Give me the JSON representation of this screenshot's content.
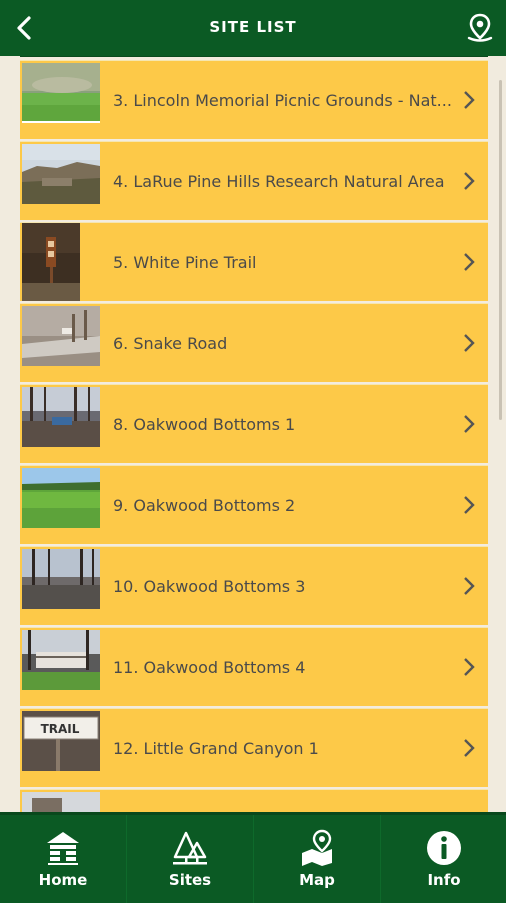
{
  "header": {
    "title": "SITE LIST",
    "back_icon": "back-chevron-icon",
    "map_pin_icon": "location-pin-icon"
  },
  "sites": [
    {
      "label": "3. Lincoln Memorial Picnic Grounds - Nat..."
    },
    {
      "label": "4. LaRue Pine Hills Research Natural Area"
    },
    {
      "label": "5. White Pine Trail"
    },
    {
      "label": "6. Snake Road"
    },
    {
      "label": "8. Oakwood Bottoms 1"
    },
    {
      "label": "9. Oakwood Bottoms 2"
    },
    {
      "label": "10. Oakwood Bottoms 3"
    },
    {
      "label": "11. Oakwood Bottoms 4"
    },
    {
      "label": "12. Little Grand Canyon 1"
    }
  ],
  "thumbnail_sign_text": "TRAIL",
  "bottom_nav": [
    {
      "label": "Home",
      "icon": "cabin-icon"
    },
    {
      "label": "Sites",
      "icon": "trees-icon"
    },
    {
      "label": "Map",
      "icon": "map-icon"
    },
    {
      "label": "Info",
      "icon": "info-icon"
    }
  ],
  "colors": {
    "primary_green": "#0b5a24",
    "row_yellow": "#fdc948",
    "background": "#f3ecdf"
  }
}
